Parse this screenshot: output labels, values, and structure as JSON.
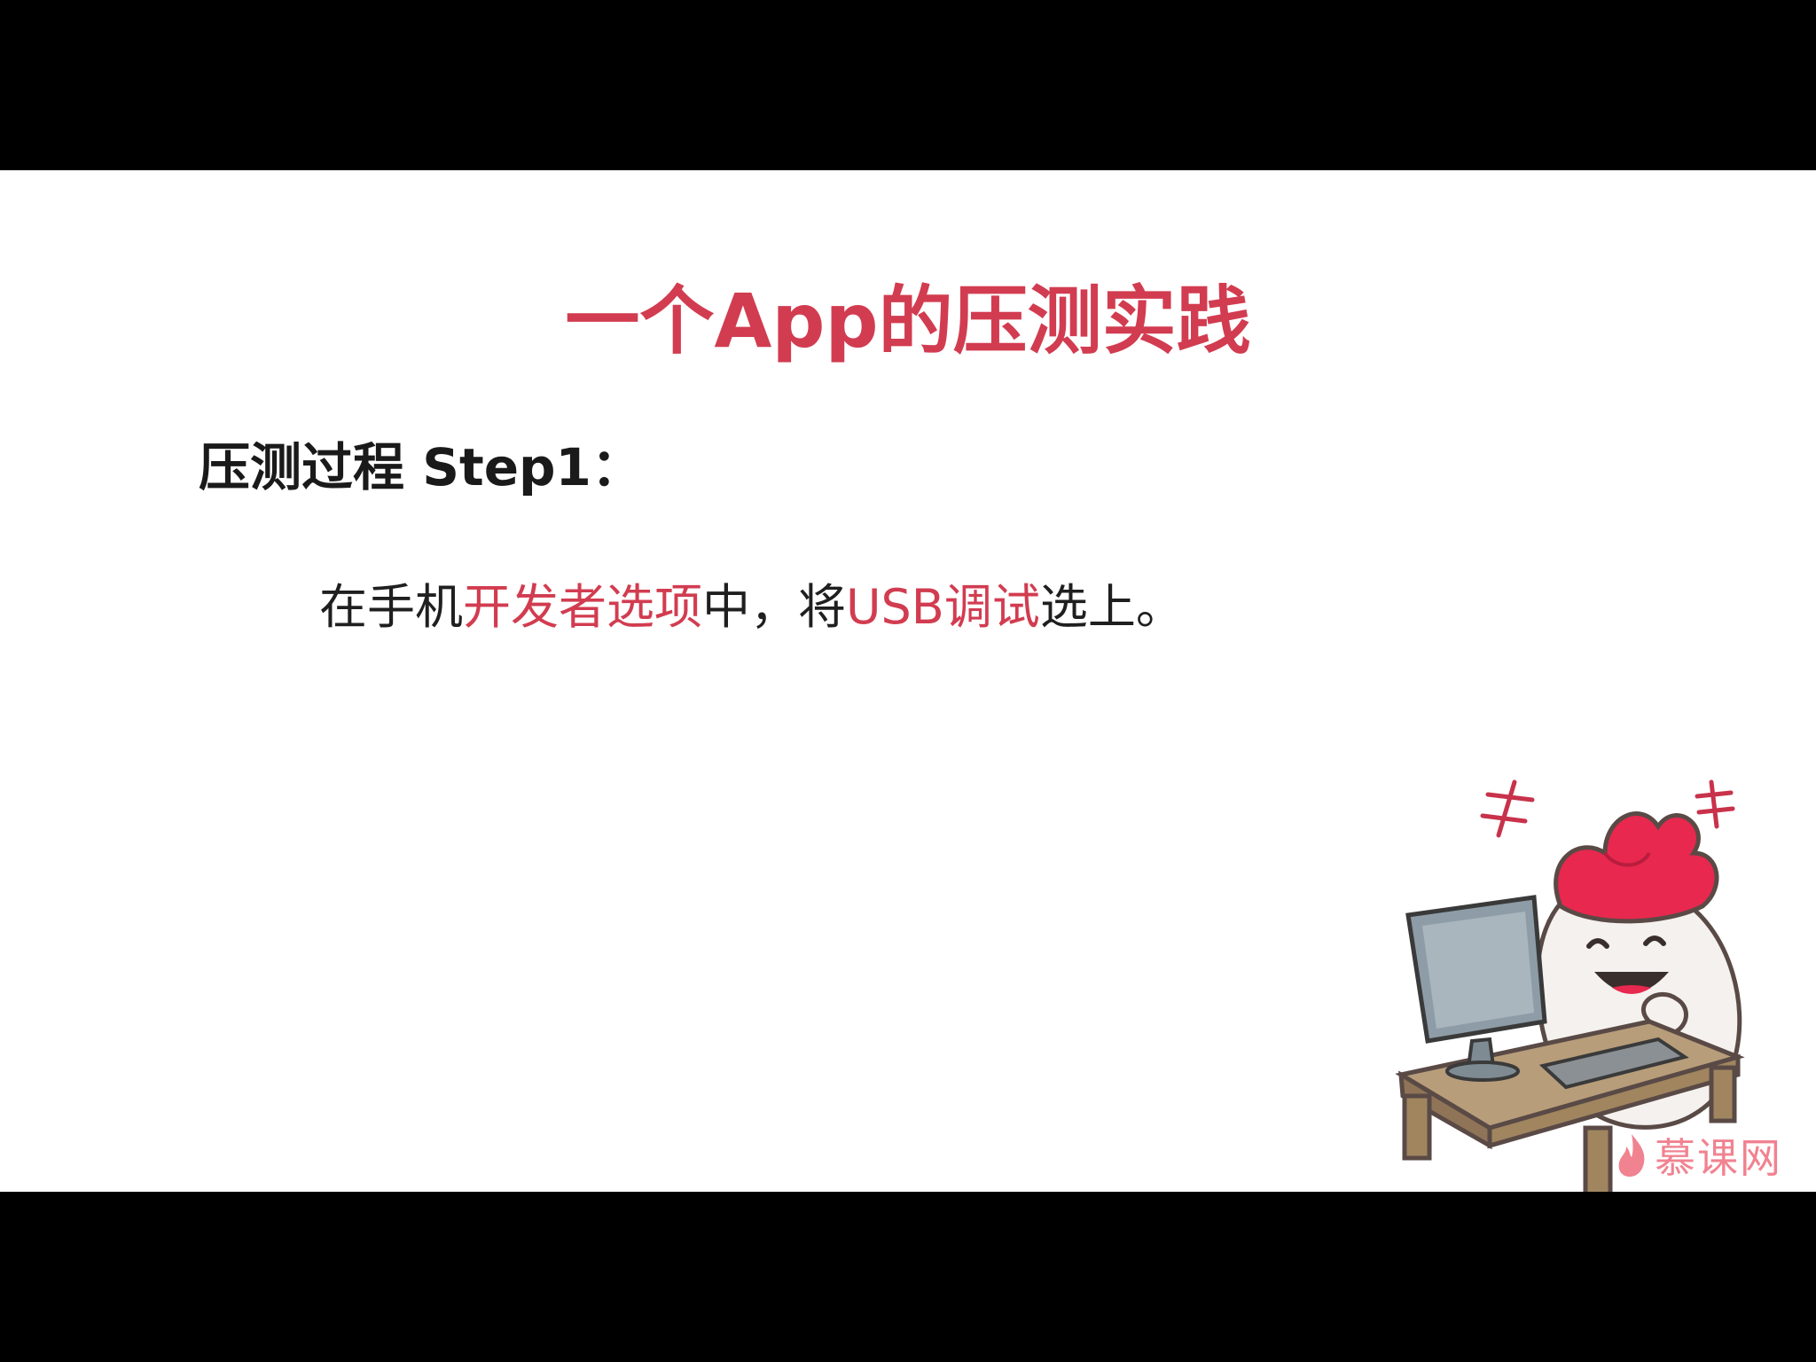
{
  "slide": {
    "title": "一个App的压测实践",
    "step_heading": "压测过程 Step1：",
    "body": {
      "part1": "在手机",
      "highlight1": "开发者选项",
      "part2": "中，将",
      "highlight2": "USB调试",
      "part3": "选上。"
    }
  },
  "watermark": {
    "text": "慕课网"
  },
  "colors": {
    "accent": "#d23c50",
    "text": "#1a1a1a",
    "background": "#ffffff",
    "letterbox": "#000000"
  },
  "icons": [
    "mascot-illustration",
    "computer-monitor-icon",
    "watermark-flame-icon"
  ]
}
